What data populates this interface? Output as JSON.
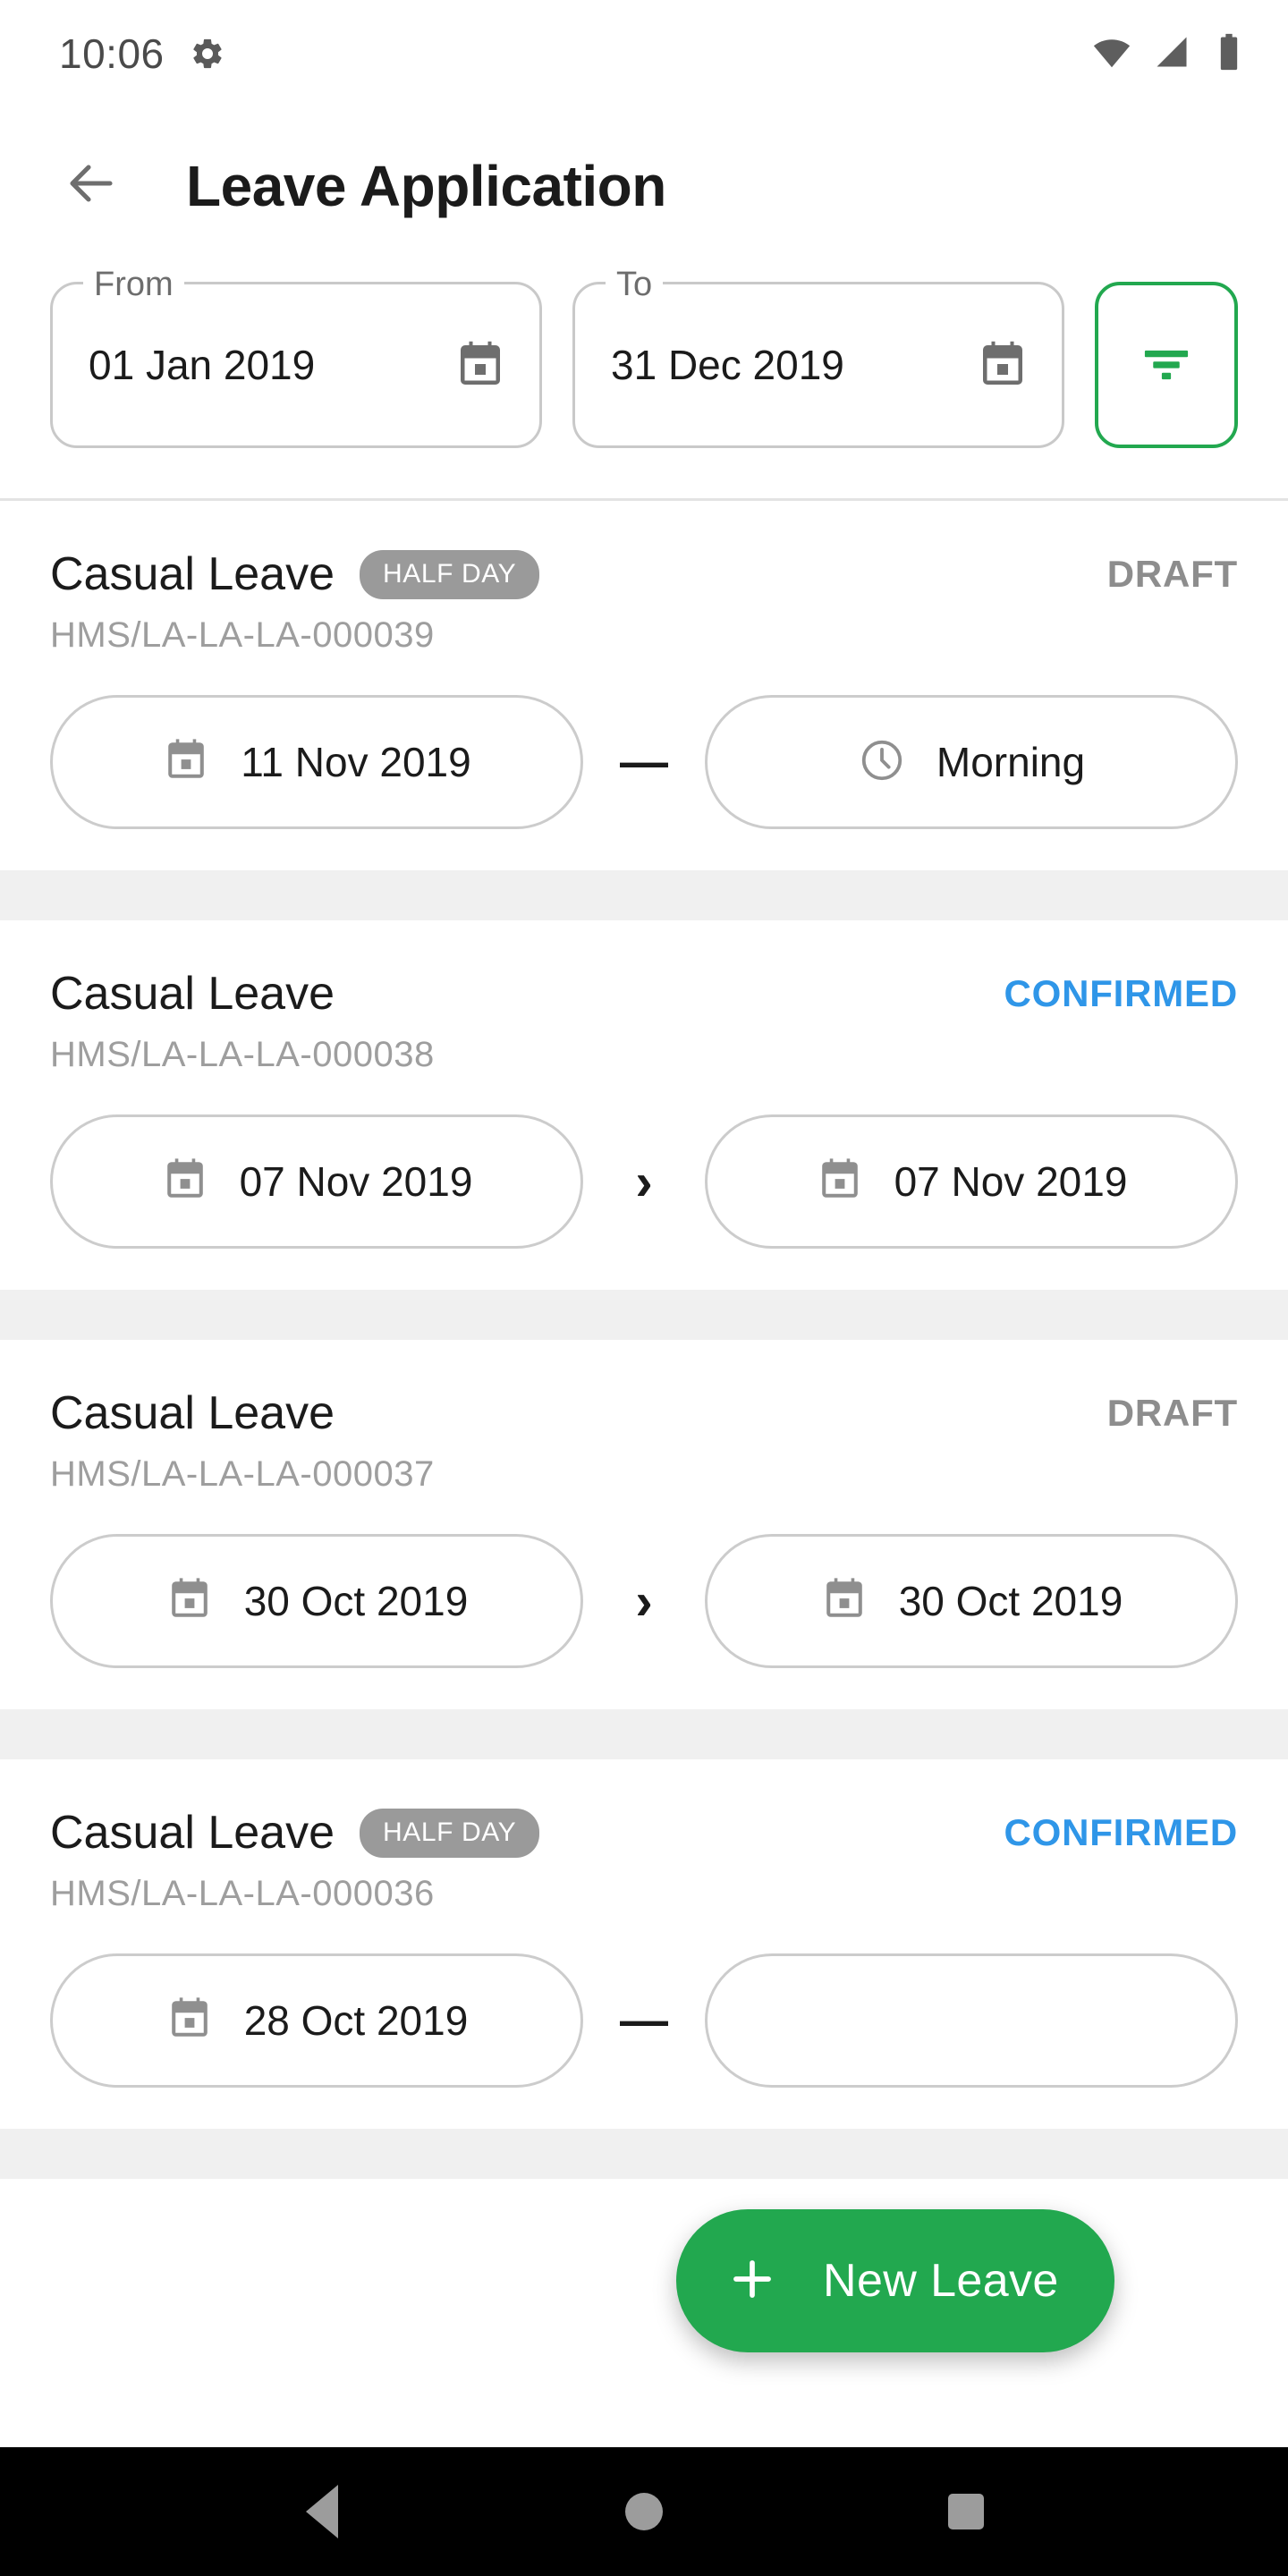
{
  "statusbar": {
    "time": "10:06",
    "gear_icon": "gear-icon",
    "wifi_icon": "wifi-icon",
    "signal_icon": "cellular-signal-icon",
    "battery_icon": "battery-full-icon"
  },
  "appbar": {
    "back_icon": "arrow-left-icon",
    "title": "Leave Application"
  },
  "filters": {
    "from": {
      "label": "From",
      "value": "01 Jan 2019",
      "icon": "calendar-icon"
    },
    "to": {
      "label": "To",
      "value": "31 Dec 2019",
      "icon": "calendar-icon"
    },
    "filter_button": {
      "icon": "filter-icon",
      "accent_color": "#22a84f"
    }
  },
  "colors": {
    "green_accent": "#22a84f",
    "blue_status": "#2f96e8",
    "grey_status": "#8d8d8d",
    "badge_grey": "#9a9a9a",
    "divider": "#f0f0f0"
  },
  "leaves": [
    {
      "type": "Casual Leave",
      "badge": "HALF DAY",
      "status": "DRAFT",
      "status_kind": "draft",
      "id": "HMS/LA-LA-LA-000039",
      "from_date": "11 Nov 2019",
      "from_icon": "calendar-icon",
      "separator": "—",
      "separator_kind": "dash",
      "to_date": "Morning",
      "to_icon": "clock-icon"
    },
    {
      "type": "Casual Leave",
      "badge": "",
      "status": "CONFIRMED",
      "status_kind": "confirmed",
      "id": "HMS/LA-LA-LA-000038",
      "from_date": "07 Nov 2019",
      "from_icon": "calendar-icon",
      "separator": "›",
      "separator_kind": "chevron",
      "to_date": "07 Nov 2019",
      "to_icon": "calendar-icon"
    },
    {
      "type": "Casual Leave",
      "badge": "",
      "status": "DRAFT",
      "status_kind": "draft",
      "id": "HMS/LA-LA-LA-000037",
      "from_date": "30 Oct 2019",
      "from_icon": "calendar-icon",
      "separator": "›",
      "separator_kind": "chevron",
      "to_date": "30 Oct 2019",
      "to_icon": "calendar-icon"
    },
    {
      "type": "Casual Leave",
      "badge": "HALF DAY",
      "status": "CONFIRMED",
      "status_kind": "confirmed",
      "id": "HMS/LA-LA-LA-000036",
      "from_date": "28 Oct 2019",
      "from_icon": "calendar-icon",
      "separator": "—",
      "separator_kind": "dash",
      "to_date": "",
      "to_icon": "calendar-icon"
    }
  ],
  "fab": {
    "label": "New Leave",
    "icon": "plus-icon"
  },
  "navbar": {
    "back": "nav-back-icon",
    "home": "nav-home-icon",
    "recents": "nav-recents-icon"
  }
}
